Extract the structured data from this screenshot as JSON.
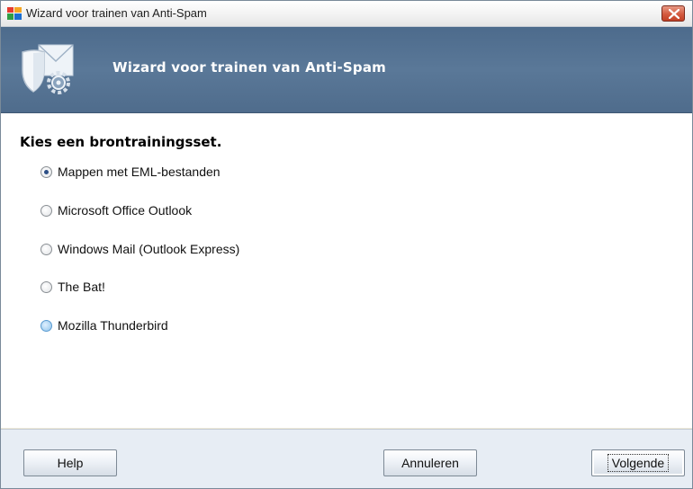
{
  "window": {
    "title": "Wizard voor trainen van Anti-Spam"
  },
  "header": {
    "title": "Wizard voor trainen van Anti-Spam"
  },
  "content": {
    "heading": "Kies een brontrainingsset.",
    "options": [
      {
        "label": "Mappen met EML-bestanden",
        "selected": true
      },
      {
        "label": "Microsoft Office Outlook",
        "selected": false
      },
      {
        "label": "Windows Mail (Outlook Express)",
        "selected": false
      },
      {
        "label": "The Bat!",
        "selected": false
      },
      {
        "label": "Mozilla Thunderbird",
        "selected": false
      }
    ]
  },
  "footer": {
    "help_label": "Help",
    "cancel_label": "Annuleren",
    "next_label": "Volgende"
  },
  "colors": {
    "header_bg": "#55728f",
    "close_button": "#d45a3f",
    "footer_bg": "#e7edf4"
  },
  "icons": {
    "app": "avg-app-icon",
    "header": "shield-mail-gear-icon",
    "close": "close-icon"
  }
}
